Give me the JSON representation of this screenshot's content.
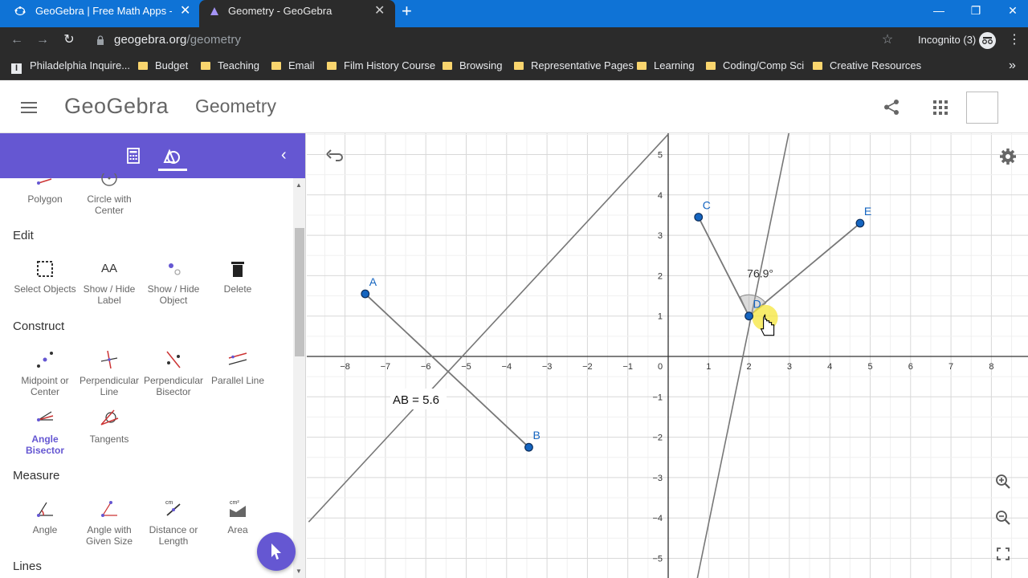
{
  "browser": {
    "tabs": [
      {
        "title": "GeoGebra | Free Math Apps - use",
        "active": false
      },
      {
        "title": "Geometry - GeoGebra",
        "active": true
      }
    ],
    "new_tab_icon": "plus-icon",
    "url_host": "geogebra.org",
    "url_path": "/geometry",
    "incognito_label": "Incognito (3)",
    "bookmarks": [
      "Philadelphia Inquire...",
      "Budget",
      "Teaching",
      "Email",
      "Film History Course",
      "Browsing",
      "Representative Pages",
      "Learning",
      "Coding/Comp Sci",
      "Creative Resources"
    ],
    "bookmarks_overflow": "»"
  },
  "app": {
    "logo": "GeoGebra",
    "title": "Geometry"
  },
  "panel": {
    "top_tools": [
      {
        "label": "Polygon"
      },
      {
        "label": "Circle with Center"
      }
    ],
    "sections": {
      "edit": "Edit",
      "construct": "Construct",
      "measure": "Measure",
      "lines": "Lines"
    },
    "edit_tools": [
      {
        "label": "Select Objects"
      },
      {
        "label": "Show / Hide Label"
      },
      {
        "label": "Show / Hide Object"
      },
      {
        "label": "Delete"
      }
    ],
    "construct_tools": [
      {
        "label": "Midpoint or Center"
      },
      {
        "label": "Perpendicular Line"
      },
      {
        "label": "Perpendicular Bisector"
      },
      {
        "label": "Parallel Line"
      },
      {
        "label": "Angle Bisector"
      },
      {
        "label": "Tangents"
      }
    ],
    "measure_tools": [
      {
        "label": "Angle"
      },
      {
        "label": "Angle with Given Size"
      },
      {
        "label": "Distance or Length"
      },
      {
        "label": "Area"
      }
    ],
    "icon_labels": {
      "area": "cm²",
      "distance": "cm",
      "label_tool": "AA"
    }
  },
  "graphics": {
    "x_ticks": [
      "−8",
      "−7",
      "−6",
      "−5",
      "−4",
      "−3",
      "−2",
      "−1",
      "0",
      "1",
      "2",
      "3",
      "4",
      "5",
      "6",
      "7",
      "8"
    ],
    "y_ticks": [
      "5",
      "4",
      "3",
      "2",
      "1",
      "−1",
      "−2",
      "−3",
      "−4",
      "−5"
    ],
    "points": [
      {
        "name": "A",
        "x": -7.5,
        "y": 1.55
      },
      {
        "name": "B",
        "x": -3.45,
        "y": -2.25
      },
      {
        "name": "C",
        "x": 0.75,
        "y": 3.45
      },
      {
        "name": "D",
        "x": 2.0,
        "y": 1.0
      },
      {
        "name": "E",
        "x": 4.75,
        "y": 3.3
      }
    ],
    "segment_label": "AB = 5.6",
    "angle_label": "76.9°"
  },
  "colors": {
    "brand": "#6557d2",
    "tabbar": "#0f73d6",
    "point": "#1565c0",
    "point_label": "#1565c0",
    "line": "#777777"
  }
}
